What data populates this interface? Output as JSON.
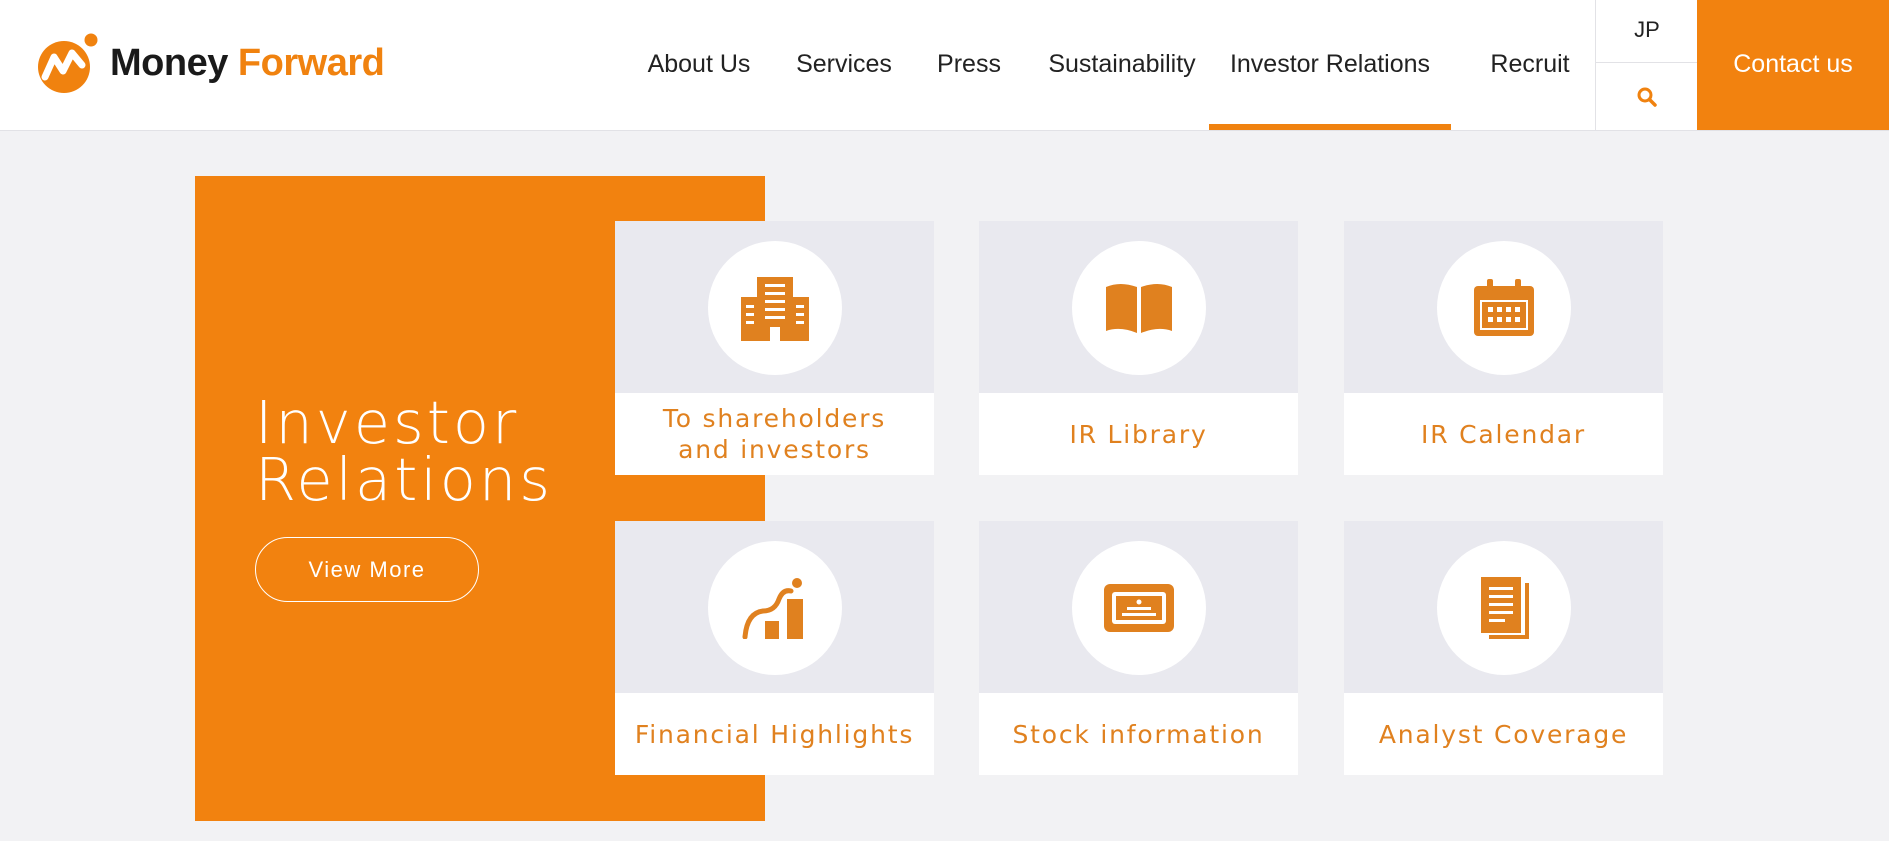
{
  "header": {
    "logo": {
      "word1": "Money",
      "word2": "Forward"
    },
    "nav": [
      {
        "label": "About Us"
      },
      {
        "label": "Services"
      },
      {
        "label": "Press"
      },
      {
        "label": "Sustainability"
      },
      {
        "label": "Investor Relations",
        "active": true
      },
      {
        "label": "Recruit"
      }
    ],
    "language": "JP",
    "search_icon": "search-icon",
    "contact_label": "Contact us"
  },
  "hero": {
    "title_line1": "Investor",
    "title_line2": "Relations",
    "button_label": "View More"
  },
  "cards": [
    {
      "label": "To shareholders\nand investors",
      "icon": "building-icon"
    },
    {
      "label": "IR Library",
      "icon": "book-icon"
    },
    {
      "label": "IR Calendar",
      "icon": "calendar-icon"
    },
    {
      "label": "Financial Highlights",
      "icon": "chart-icon"
    },
    {
      "label": "Stock information",
      "icon": "stock-certificate-icon"
    },
    {
      "label": "Analyst Coverage",
      "icon": "document-icon"
    }
  ],
  "colors": {
    "accent": "#f2820f",
    "text_accent": "#e0811f",
    "background": "#f2f2f4",
    "card_top": "#e9e9ef"
  }
}
